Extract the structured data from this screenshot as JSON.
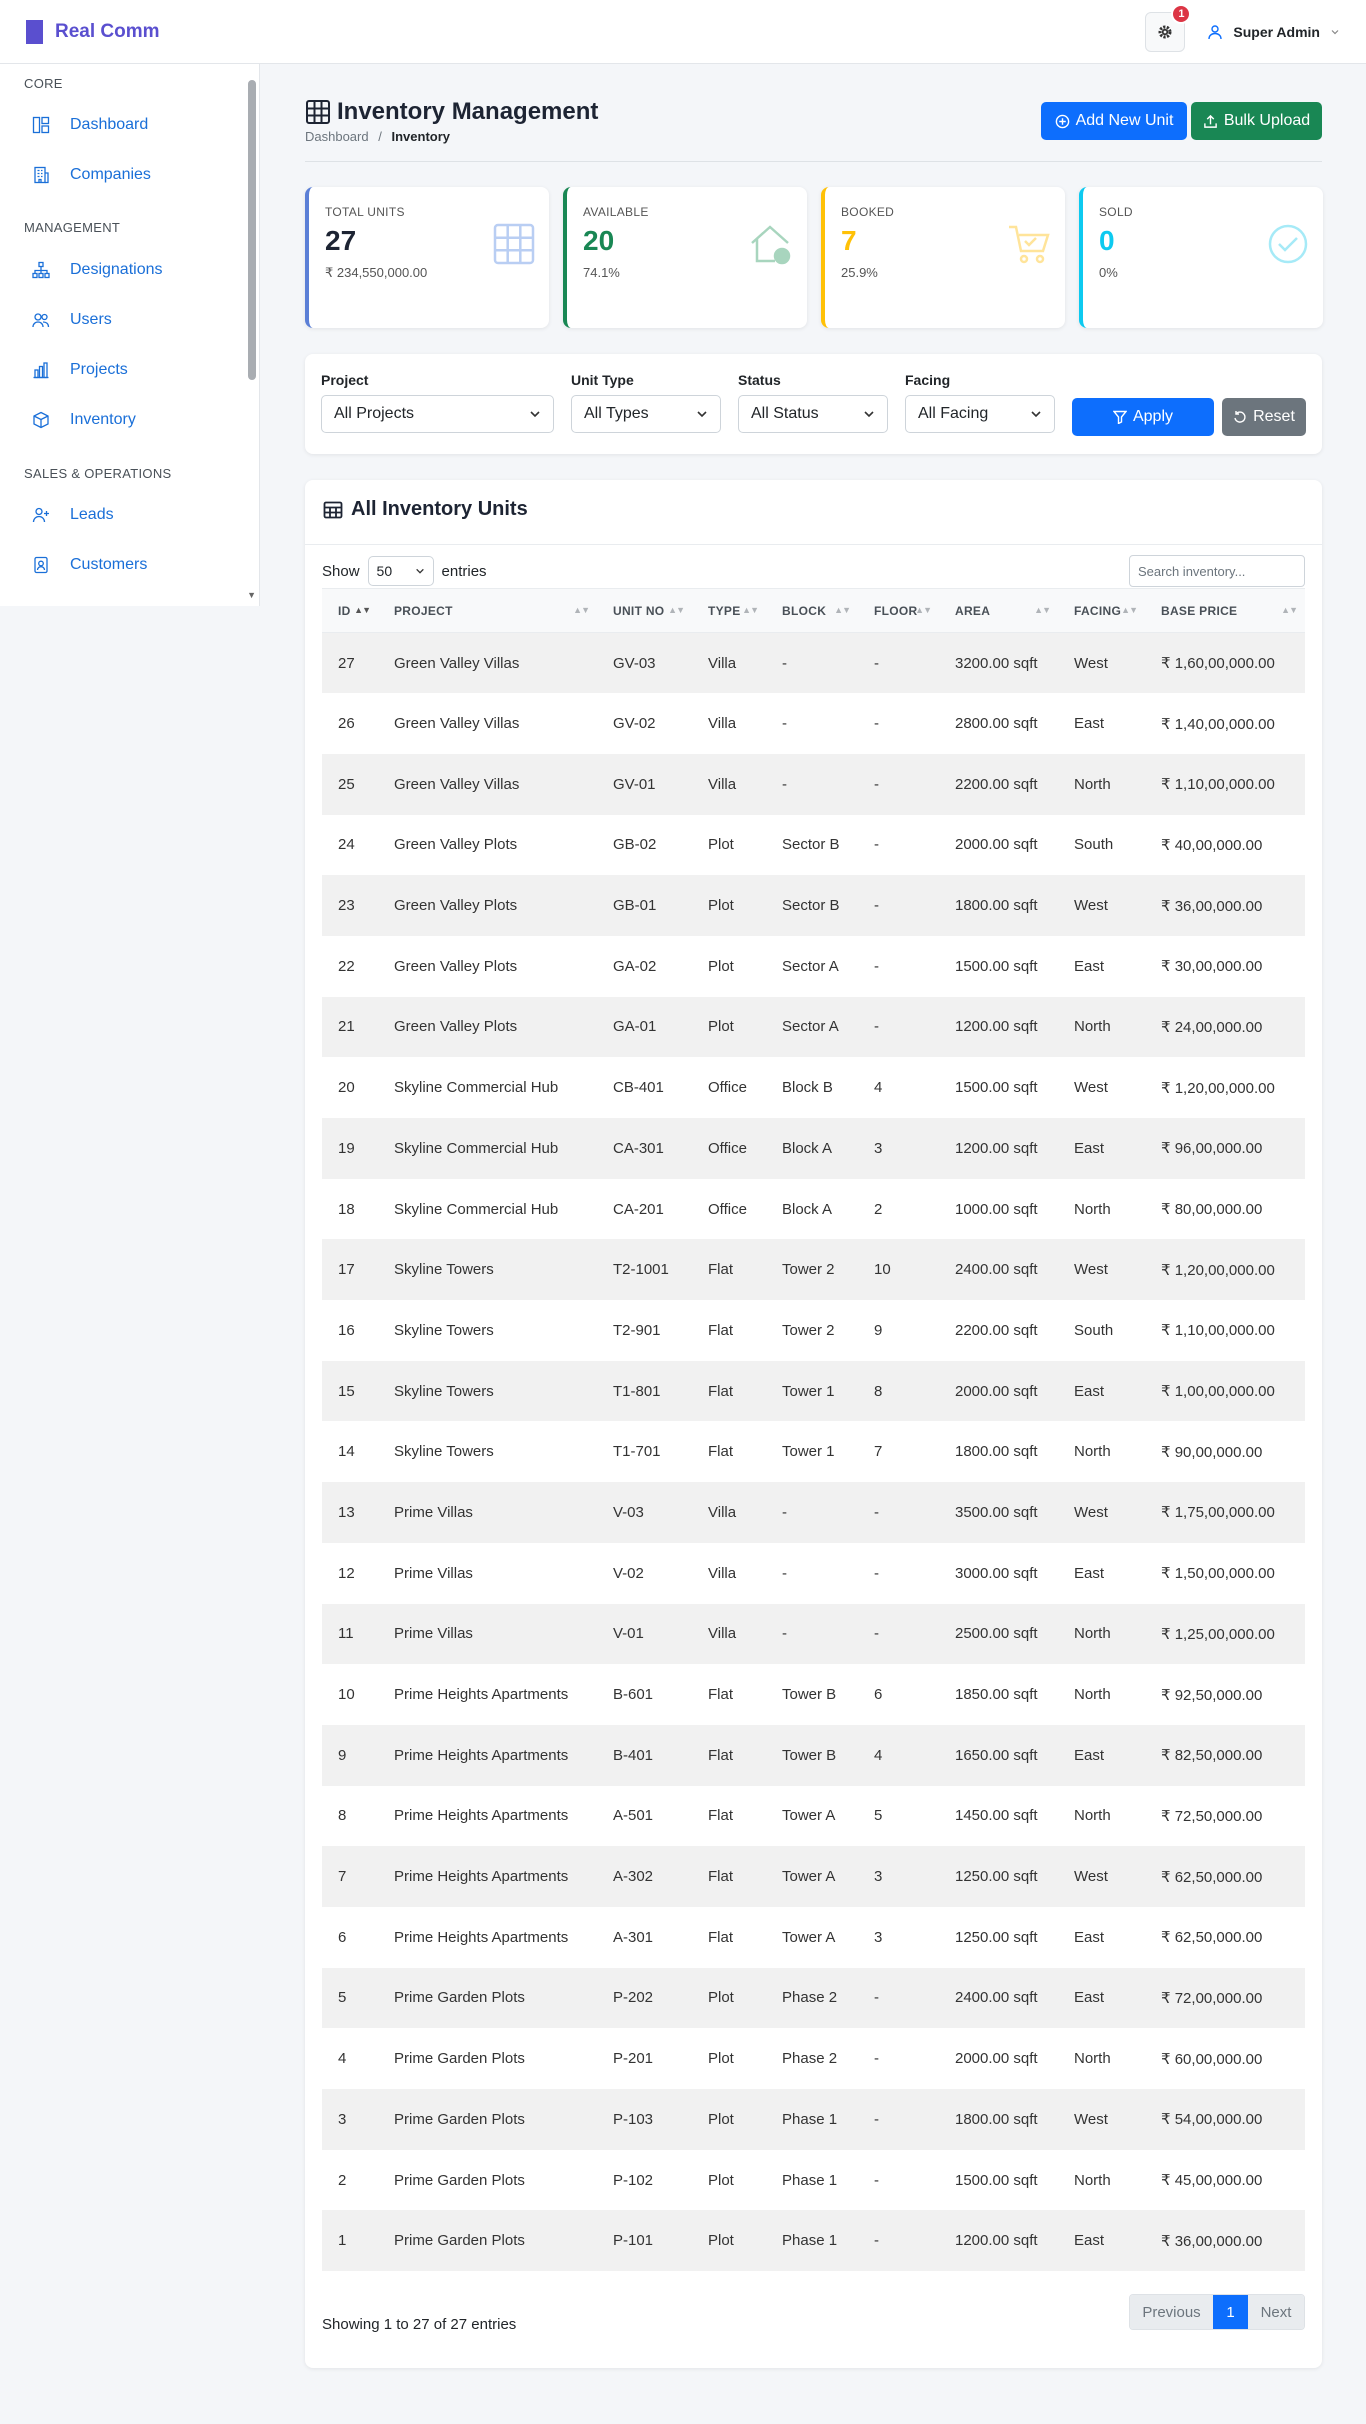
{
  "brand": {
    "name": "Real Comm"
  },
  "topbar": {
    "notification_count": "1",
    "user_name": "Super Admin"
  },
  "sidebar": {
    "sections": [
      {
        "heading": "CORE",
        "items": [
          {
            "label": "Dashboard",
            "icon": "dashboard-icon"
          },
          {
            "label": "Companies",
            "icon": "building-icon"
          }
        ]
      },
      {
        "heading": "MANAGEMENT",
        "items": [
          {
            "label": "Designations",
            "icon": "hierarchy-icon"
          },
          {
            "label": "Users",
            "icon": "users-icon"
          },
          {
            "label": "Projects",
            "icon": "chart-bar-icon"
          },
          {
            "label": "Inventory",
            "icon": "box-icon"
          }
        ]
      },
      {
        "heading": "SALES & OPERATIONS",
        "items": [
          {
            "label": "Leads",
            "icon": "user-plus-icon"
          },
          {
            "label": "Customers",
            "icon": "id-badge-icon"
          }
        ]
      }
    ]
  },
  "page": {
    "title": "Inventory Management",
    "breadcrumb": {
      "home": "Dashboard",
      "separator": "/",
      "current": "Inventory"
    },
    "add_button": "Add New Unit",
    "bulk_button": "Bulk Upload"
  },
  "stats": [
    {
      "label": "TOTAL UNITS",
      "value": "27",
      "sub": "₹ 234,550,000.00",
      "color": "#5b7fd6",
      "icon": "grid-icon"
    },
    {
      "label": "AVAILABLE",
      "value": "20",
      "sub": "74.1%",
      "color": "#198754",
      "icon": "house-icon"
    },
    {
      "label": "BOOKED",
      "value": "7",
      "sub": "25.9%",
      "color": "#ffc107",
      "icon": "cart-icon"
    },
    {
      "label": "SOLD",
      "value": "0",
      "sub": "0%",
      "color": "#0dcaf0",
      "icon": "check-circle-icon"
    }
  ],
  "filters": {
    "project": {
      "label": "Project",
      "value": "All Projects"
    },
    "unit_type": {
      "label": "Unit Type",
      "value": "All Types"
    },
    "status": {
      "label": "Status",
      "value": "All Status"
    },
    "facing": {
      "label": "Facing",
      "value": "All Facing"
    },
    "apply": "Apply",
    "reset": "Reset"
  },
  "table": {
    "title": "All Inventory Units",
    "show_label": "Show",
    "entries_value": "50",
    "entries_label": "entries",
    "search_placeholder": "Search inventory...",
    "columns": [
      "ID",
      "PROJECT",
      "UNIT NO",
      "TYPE",
      "BLOCK",
      "FLOOR",
      "AREA",
      "FACING",
      "BASE PRICE"
    ],
    "rows": [
      [
        "27",
        "Green Valley Villas",
        "GV-03",
        "Villa",
        "-",
        "-",
        "3200.00 sqft",
        "West",
        "₹ 1,60,00,000.00"
      ],
      [
        "26",
        "Green Valley Villas",
        "GV-02",
        "Villa",
        "-",
        "-",
        "2800.00 sqft",
        "East",
        "₹ 1,40,00,000.00"
      ],
      [
        "25",
        "Green Valley Villas",
        "GV-01",
        "Villa",
        "-",
        "-",
        "2200.00 sqft",
        "North",
        "₹ 1,10,00,000.00"
      ],
      [
        "24",
        "Green Valley Plots",
        "GB-02",
        "Plot",
        "Sector B",
        "-",
        "2000.00 sqft",
        "South",
        "₹ 40,00,000.00"
      ],
      [
        "23",
        "Green Valley Plots",
        "GB-01",
        "Plot",
        "Sector B",
        "-",
        "1800.00 sqft",
        "West",
        "₹ 36,00,000.00"
      ],
      [
        "22",
        "Green Valley Plots",
        "GA-02",
        "Plot",
        "Sector A",
        "-",
        "1500.00 sqft",
        "East",
        "₹ 30,00,000.00"
      ],
      [
        "21",
        "Green Valley Plots",
        "GA-01",
        "Plot",
        "Sector A",
        "-",
        "1200.00 sqft",
        "North",
        "₹ 24,00,000.00"
      ],
      [
        "20",
        "Skyline Commercial Hub",
        "CB-401",
        "Office",
        "Block B",
        "4",
        "1500.00 sqft",
        "West",
        "₹ 1,20,00,000.00"
      ],
      [
        "19",
        "Skyline Commercial Hub",
        "CA-301",
        "Office",
        "Block A",
        "3",
        "1200.00 sqft",
        "East",
        "₹ 96,00,000.00"
      ],
      [
        "18",
        "Skyline Commercial Hub",
        "CA-201",
        "Office",
        "Block A",
        "2",
        "1000.00 sqft",
        "North",
        "₹ 80,00,000.00"
      ],
      [
        "17",
        "Skyline Towers",
        "T2-1001",
        "Flat",
        "Tower 2",
        "10",
        "2400.00 sqft",
        "West",
        "₹ 1,20,00,000.00"
      ],
      [
        "16",
        "Skyline Towers",
        "T2-901",
        "Flat",
        "Tower 2",
        "9",
        "2200.00 sqft",
        "South",
        "₹ 1,10,00,000.00"
      ],
      [
        "15",
        "Skyline Towers",
        "T1-801",
        "Flat",
        "Tower 1",
        "8",
        "2000.00 sqft",
        "East",
        "₹ 1,00,00,000.00"
      ],
      [
        "14",
        "Skyline Towers",
        "T1-701",
        "Flat",
        "Tower 1",
        "7",
        "1800.00 sqft",
        "North",
        "₹ 90,00,000.00"
      ],
      [
        "13",
        "Prime Villas",
        "V-03",
        "Villa",
        "-",
        "-",
        "3500.00 sqft",
        "West",
        "₹ 1,75,00,000.00"
      ],
      [
        "12",
        "Prime Villas",
        "V-02",
        "Villa",
        "-",
        "-",
        "3000.00 sqft",
        "East",
        "₹ 1,50,00,000.00"
      ],
      [
        "11",
        "Prime Villas",
        "V-01",
        "Villa",
        "-",
        "-",
        "2500.00 sqft",
        "North",
        "₹ 1,25,00,000.00"
      ],
      [
        "10",
        "Prime Heights Apartments",
        "B-601",
        "Flat",
        "Tower B",
        "6",
        "1850.00 sqft",
        "North",
        "₹ 92,50,000.00"
      ],
      [
        "9",
        "Prime Heights Apartments",
        "B-401",
        "Flat",
        "Tower B",
        "4",
        "1650.00 sqft",
        "East",
        "₹ 82,50,000.00"
      ],
      [
        "8",
        "Prime Heights Apartments",
        "A-501",
        "Flat",
        "Tower A",
        "5",
        "1450.00 sqft",
        "North",
        "₹ 72,50,000.00"
      ],
      [
        "7",
        "Prime Heights Apartments",
        "A-302",
        "Flat",
        "Tower A",
        "3",
        "1250.00 sqft",
        "West",
        "₹ 62,50,000.00"
      ],
      [
        "6",
        "Prime Heights Apartments",
        "A-301",
        "Flat",
        "Tower A",
        "3",
        "1250.00 sqft",
        "East",
        "₹ 62,50,000.00"
      ],
      [
        "5",
        "Prime Garden Plots",
        "P-202",
        "Plot",
        "Phase 2",
        "-",
        "2400.00 sqft",
        "East",
        "₹ 72,00,000.00"
      ],
      [
        "4",
        "Prime Garden Plots",
        "P-201",
        "Plot",
        "Phase 2",
        "-",
        "2000.00 sqft",
        "North",
        "₹ 60,00,000.00"
      ],
      [
        "3",
        "Prime Garden Plots",
        "P-103",
        "Plot",
        "Phase 1",
        "-",
        "1800.00 sqft",
        "West",
        "₹ 54,00,000.00"
      ],
      [
        "2",
        "Prime Garden Plots",
        "P-102",
        "Plot",
        "Phase 1",
        "-",
        "1500.00 sqft",
        "North",
        "₹ 45,00,000.00"
      ],
      [
        "1",
        "Prime Garden Plots",
        "P-101",
        "Plot",
        "Phase 1",
        "-",
        "1200.00 sqft",
        "East",
        "₹ 36,00,000.00"
      ]
    ],
    "info": "Showing 1 to 27 of 27 entries",
    "pagination": {
      "previous": "Previous",
      "current": "1",
      "next": "Next"
    }
  }
}
